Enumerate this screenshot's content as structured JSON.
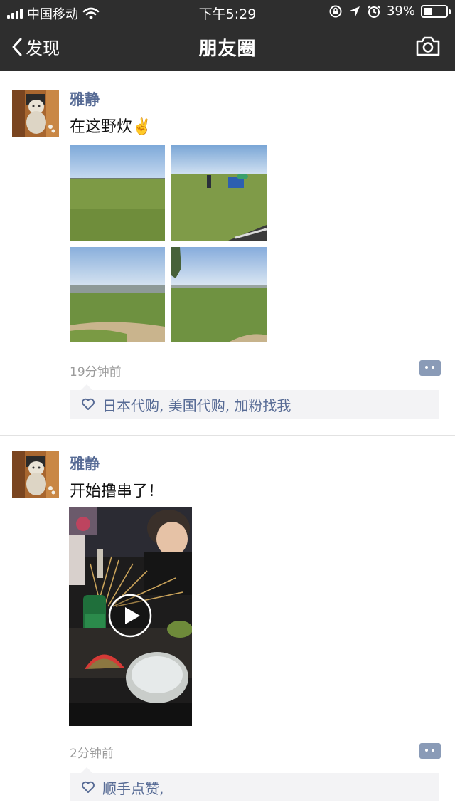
{
  "status_bar": {
    "carrier": "中国移动",
    "time": "下午5:29",
    "battery": "39%",
    "battery_level": 0.39
  },
  "nav": {
    "back_label": "发现",
    "title": "朋友圈",
    "camera_icon": "camera-icon"
  },
  "posts": [
    {
      "author": "雅静",
      "text": "在这野炊✌️",
      "time": "19分钟前",
      "likes": "日本代购, 美国代购, 加粉找我",
      "media_type": "photos"
    },
    {
      "author": "雅静",
      "text": "开始撸串了！",
      "time": "2分钟前",
      "likes": "顺手点赞,",
      "media_type": "video"
    }
  ],
  "colors": {
    "nav_bg": "#2e2e2e",
    "name_color": "#576b95",
    "like_bg": "#f3f3f5",
    "time_color": "#9b9b9b"
  }
}
